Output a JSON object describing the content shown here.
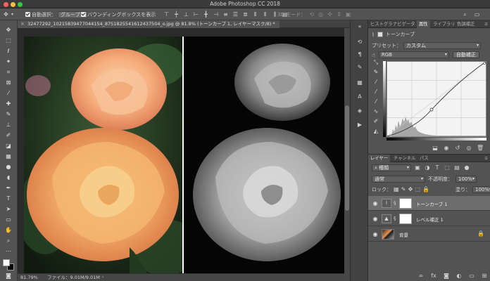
{
  "app": {
    "title": "Adobe Photoshop CC 2018"
  },
  "options_bar": {
    "auto_select_label": "自動選択：",
    "auto_select_value": "グループ",
    "bbox_label": "バウンディングボックスを表示",
    "mode_3d_label": "3D モード："
  },
  "document": {
    "tab_title": "32477292_10215839477044154_8751825541612437504_o.jpg @ 81.8% (トーンカーブ 1, レイヤーマスク/8) *",
    "zoom": "81.79%",
    "file_info": "ファイル：9.01M/9.01M"
  },
  "properties_panel": {
    "tabs": [
      "ヒストグラ",
      "ナビゲータ",
      "属性",
      "ライブラリ",
      "色調補正"
    ],
    "active_tab": 2,
    "header_label": "トーンカーブ",
    "preset_label": "プリセット：",
    "preset_value": "カスタム",
    "channel_value": "RGB",
    "auto_button": "自動補正"
  },
  "layers_panel": {
    "tabs": [
      "レイヤー",
      "チャンネル",
      "パス"
    ],
    "active_tab": 0,
    "filter_value": "種類",
    "blend_mode": "通常",
    "opacity_label": "不透明度：",
    "opacity_value": "100%",
    "lock_label": "ロック：",
    "fill_label": "塗り：",
    "fill_value": "100%",
    "layers": [
      {
        "name": "トーンカーブ 1",
        "selected": true
      },
      {
        "name": "レベル補正 1",
        "selected": false
      },
      {
        "name": "背景",
        "selected": false
      }
    ]
  },
  "colors": {
    "ui_bg": "#535353",
    "panel_dark": "#3e3e3e",
    "rose_orange": "#f0a060",
    "rose_peach": "#f5b88a"
  }
}
